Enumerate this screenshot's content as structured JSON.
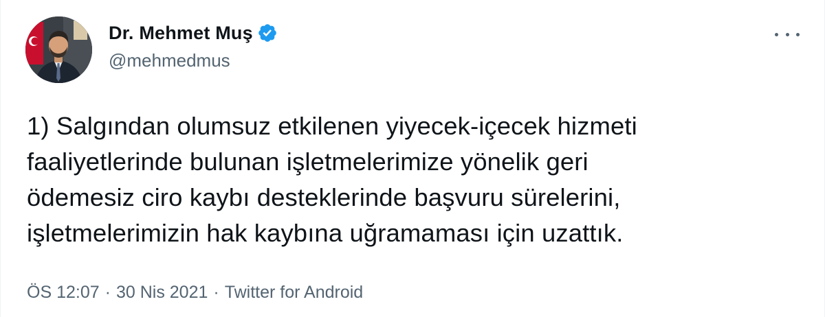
{
  "author": {
    "display_name": "Dr. Mehmet Muş",
    "handle": "@mehmedmus",
    "verified": true
  },
  "icons": {
    "verified": "verified-badge-icon",
    "more": "more-options-icon",
    "avatar": "profile-photo"
  },
  "colors": {
    "verified_blue": "#1d9bf0",
    "text": "#0f1419",
    "secondary": "#536471"
  },
  "tweet": {
    "lines": [
      "1) Salgından olumsuz etkilenen yiyecek-içecek hizmeti",
      "faaliyetlerinde bulunan işletmelerimize yönelik geri",
      "ödemesiz ciro kaybı desteklerinde başvuru sürelerini,",
      "işletmelerimizin hak kaybına uğramaması için uzattık."
    ]
  },
  "meta": {
    "time": "ÖS 12:07",
    "separator": "·",
    "date": "30 Nis 2021",
    "source": "Twitter for Android"
  }
}
